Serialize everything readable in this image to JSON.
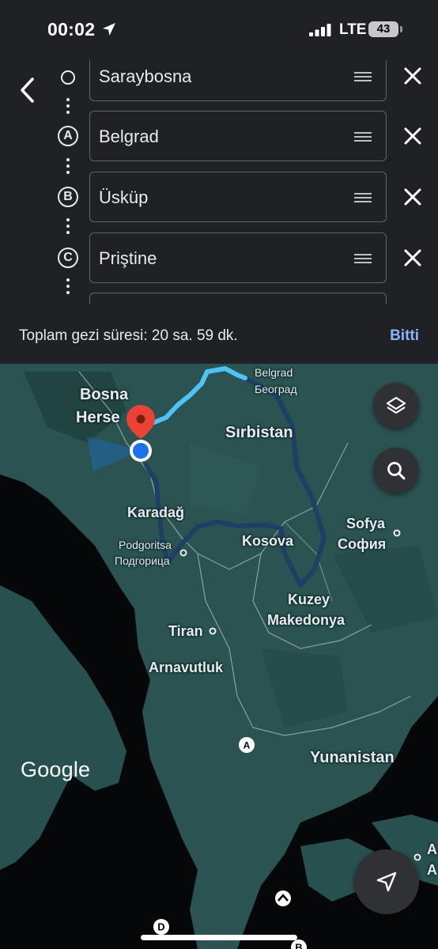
{
  "status_bar": {
    "time": "00:02",
    "network": "LTE",
    "battery": "43"
  },
  "directions": {
    "stops": [
      {
        "marker": "",
        "label": "Saraybosna"
      },
      {
        "marker": "A",
        "label": "Belgrad"
      },
      {
        "marker": "B",
        "label": "Üsküp"
      },
      {
        "marker": "C",
        "label": "Priştine"
      }
    ],
    "total_time": "Toplam gezi süresi: 20 sa. 59 dk.",
    "done_label": "Bitti"
  },
  "map": {
    "countries": {
      "bosnia_1": "Bosna",
      "bosnia_2": "Herse",
      "serbia": "Sırbistan",
      "montenegro": "Karadağ",
      "kosovo": "Kosova",
      "north_macedonia_1": "Kuzey",
      "north_macedonia_2": "Makedonya",
      "albania": "Arnavutluk",
      "greece": "Yunanistan"
    },
    "cities": {
      "belgrade_latin": "Belgrad",
      "belgrade_cyrillic": "Београд",
      "sofia_latin": "Sofya",
      "sofia_cyrillic": "София",
      "podgorica_latin": "Podgoritsa",
      "podgorica_cyrillic": "Подгорица",
      "tirana": "Tiran",
      "athens_partial_1": "A",
      "athens_partial_2": "A"
    },
    "markers": {
      "a": "A",
      "b": "B",
      "d": "D"
    },
    "brand": "Google",
    "colors": {
      "route_active": "#4fc3f7",
      "route_alt": "#1e3f66",
      "land": "#2b5351",
      "sea": "#060708",
      "marker_red": "#ea4335",
      "marker_blue": "#1a73e8"
    }
  }
}
